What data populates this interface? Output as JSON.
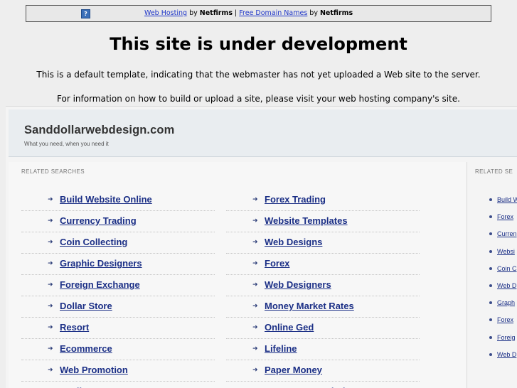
{
  "topbar": {
    "icon": "?",
    "link1": "Web Hosting",
    "by1": " by ",
    "brand1": "Netfirms",
    "sep": " | ",
    "link2": "Free Domain Names",
    "by2": " by ",
    "brand2": "Netfirms"
  },
  "heading": "This site is under development",
  "message1": "This is a default template, indicating that the webmaster has not yet uploaded a Web site to the server.",
  "message2": "For information on how to build or upload a site, please visit your web hosting company's site.",
  "frame": {
    "site_name": "Sanddollarwebdesign.com",
    "tagline": "What you need, when you need it",
    "related_label": "RELATED SEARCHES",
    "side_related_label": "RELATED SE",
    "col1": [
      "Build Website Online",
      "Currency Trading",
      "Coin Collecting",
      "Graphic Designers",
      "Foreign Exchange",
      "Dollar Store",
      "Resort",
      "Ecommerce",
      "Web Promotion",
      "Trading System"
    ],
    "col2": [
      "Forex Trading",
      "Website Templates",
      "Web Designs",
      "Forex",
      "Web Designers",
      "Money Market Rates",
      "Online Ged",
      "Lifeline",
      "Paper Money",
      "Ecommerce Solution"
    ],
    "side_items": [
      "Build W",
      "Forex",
      "Curren",
      "Websi",
      "Coin C",
      "Web D",
      "Graph",
      "Forex",
      "Foreig",
      "Web D"
    ]
  }
}
